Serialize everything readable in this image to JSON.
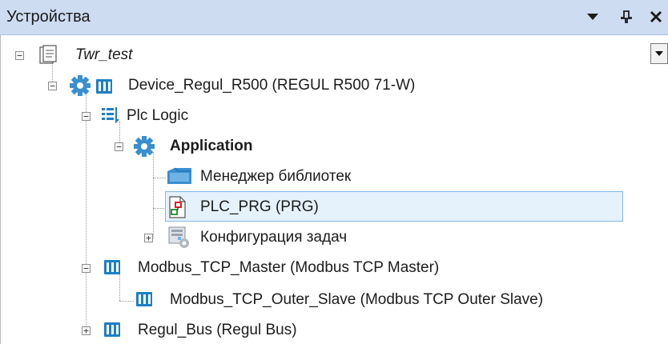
{
  "panel": {
    "title": "Устройства"
  },
  "tree": {
    "project": {
      "label": "Twr_test",
      "icon": "project-file-icon"
    },
    "device": {
      "label": "Device_Regul_R500 (REGUL R500 71-W)",
      "icon": "device-gear-icon"
    },
    "plc_logic": {
      "label": "Plc Logic",
      "icon": "plc-logic-icon"
    },
    "application": {
      "label": "Application",
      "icon": "application-gear-icon"
    },
    "library_manager": {
      "label": "Менеджер библиотек",
      "icon": "library-manager-icon"
    },
    "plc_prg": {
      "label": "PLC_PRG (PRG)",
      "icon": "program-pou-icon",
      "selected": true
    },
    "task_config": {
      "label": "Конфигурация задач",
      "icon": "task-config-icon"
    },
    "modbus_master": {
      "label": "Modbus_TCP_Master (Modbus TCP Master)",
      "icon": "modbus-device-icon"
    },
    "modbus_slave": {
      "label": "Modbus_TCP_Outer_Slave (Modbus TCP Outer Slave)",
      "icon": "modbus-device-icon"
    },
    "regul_bus": {
      "label": "Regul_Bus (Regul Bus)",
      "icon": "bus-device-icon"
    }
  },
  "colors": {
    "titlebar": "#cddcf0",
    "selection_bg": "#e5f1fb",
    "selection_border": "#84b8e6",
    "device_blue": "#1d7fc4",
    "gear_blue": "#3a8fd0"
  }
}
